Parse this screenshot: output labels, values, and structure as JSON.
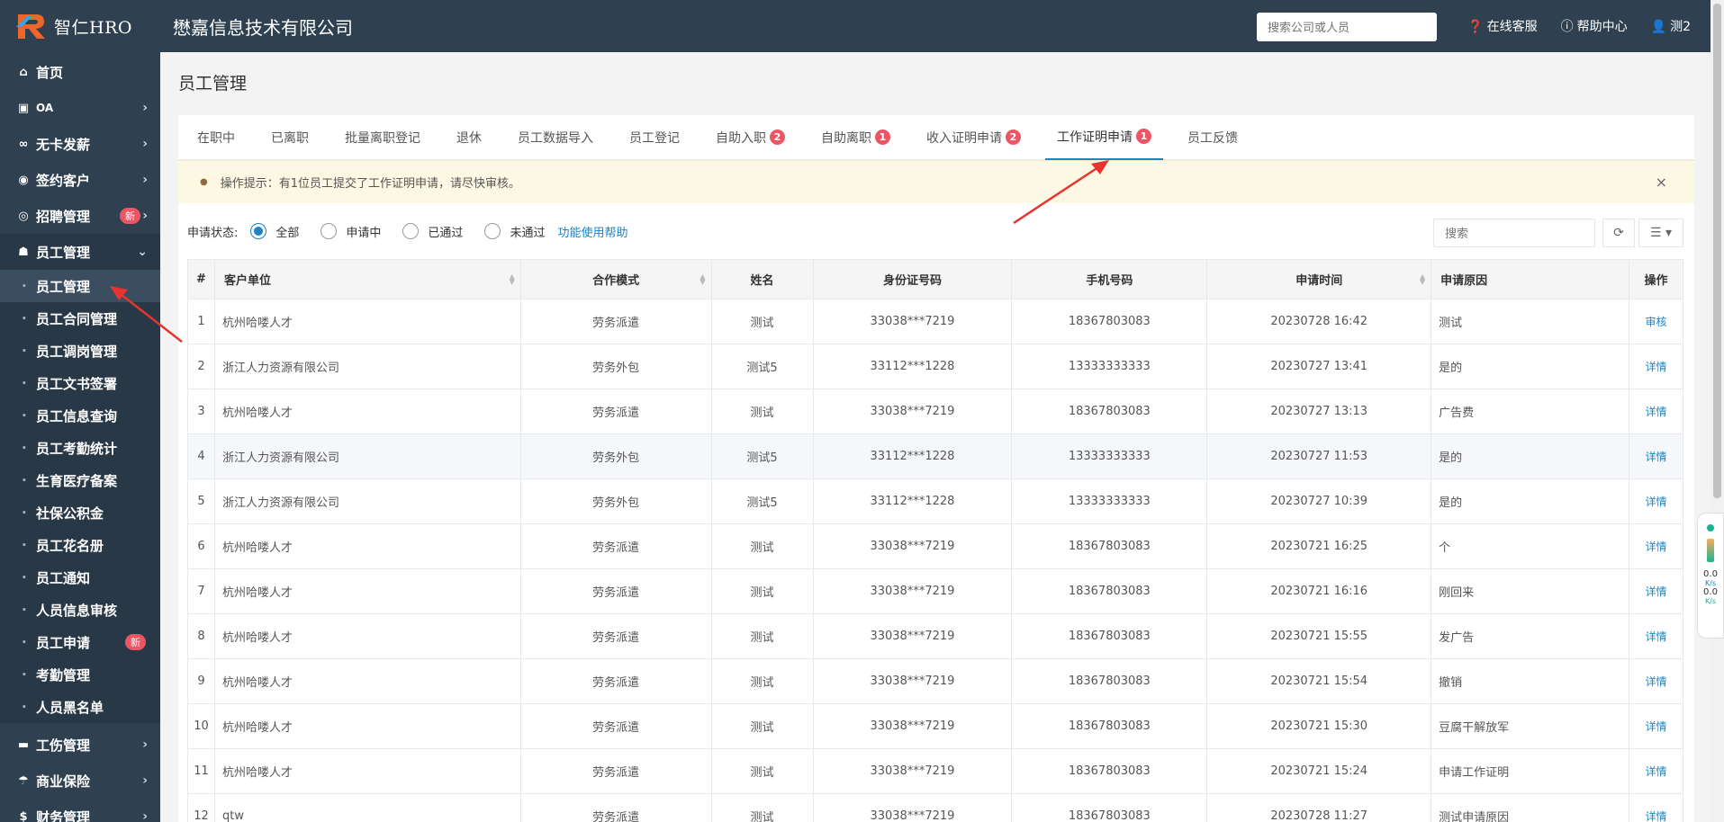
{
  "brand": {
    "name": "智仁HRO"
  },
  "sidebar": {
    "items": [
      {
        "label": "首页",
        "icon": "home-icon"
      },
      {
        "label": "OA",
        "icon": "calendar-icon"
      },
      {
        "label": "无卡发薪",
        "icon": "link-icon"
      },
      {
        "label": "签约客户",
        "icon": "user-circle-icon"
      },
      {
        "label": "招聘管理",
        "icon": "eye-icon",
        "badge": "新"
      },
      {
        "label": "员工管理",
        "icon": "users-icon"
      }
    ],
    "submenu": [
      {
        "label": "员工管理"
      },
      {
        "label": "员工合同管理"
      },
      {
        "label": "员工调岗管理"
      },
      {
        "label": "员工文书签署"
      },
      {
        "label": "员工信息查询"
      },
      {
        "label": "员工考勤统计"
      },
      {
        "label": "生育医疗备案"
      },
      {
        "label": "社保公积金"
      },
      {
        "label": "员工花名册"
      },
      {
        "label": "员工通知"
      },
      {
        "label": "人员信息审核"
      },
      {
        "label": "员工申请",
        "badge": "新"
      },
      {
        "label": "考勤管理"
      },
      {
        "label": "人员黑名单"
      }
    ],
    "bottom_items": [
      {
        "label": "工伤管理",
        "icon": "briefcase-icon"
      },
      {
        "label": "商业保险",
        "icon": "umbrella-icon"
      },
      {
        "label": "财务管理",
        "icon": "money-icon"
      }
    ]
  },
  "topbar": {
    "company": "懋嘉信息技术有限公司",
    "search_placeholder": "搜索公司或人员",
    "links": [
      "在线客服",
      "帮助中心",
      "测2"
    ]
  },
  "page": {
    "title": "员工管理"
  },
  "tabs": [
    {
      "label": "在职中"
    },
    {
      "label": "已离职"
    },
    {
      "label": "批量离职登记"
    },
    {
      "label": "退休"
    },
    {
      "label": "员工数据导入"
    },
    {
      "label": "员工登记"
    },
    {
      "label": "自助入职",
      "count": "2"
    },
    {
      "label": "自助离职",
      "count": "1"
    },
    {
      "label": "收入证明申请",
      "count": "2"
    },
    {
      "label": "工作证明申请",
      "count": "1",
      "active": true
    },
    {
      "label": "员工反馈"
    }
  ],
  "alert": {
    "text": "操作提示：有1位员工提交了工作证明申请，请尽快审核。",
    "close": "×"
  },
  "filter": {
    "label": "申请状态:",
    "options": [
      "全部",
      "申请中",
      "已通过",
      "未通过"
    ],
    "selected": "全部",
    "help": "功能使用帮助",
    "search_placeholder": "搜索"
  },
  "table": {
    "headers": [
      "#",
      "客户单位",
      "合作模式",
      "姓名",
      "身份证号码",
      "手机号码",
      "申请时间",
      "申请原因",
      "操作"
    ],
    "rows": [
      [
        "1",
        "杭州哈喽人才",
        "劳务派遣",
        "测试",
        "33038***7219",
        "18367803083",
        "20230728 16:42",
        "测试",
        "审核"
      ],
      [
        "2",
        "浙江人力资源有限公司",
        "劳务外包",
        "测试5",
        "33112***1228",
        "13333333333",
        "20230727 13:41",
        "是的",
        "详情"
      ],
      [
        "3",
        "杭州哈喽人才",
        "劳务派遣",
        "测试",
        "33038***7219",
        "18367803083",
        "20230727 13:13",
        "广告费",
        "详情"
      ],
      [
        "4",
        "浙江人力资源有限公司",
        "劳务外包",
        "测试5",
        "33112***1228",
        "13333333333",
        "20230727 11:53",
        "是的",
        "详情"
      ],
      [
        "5",
        "浙江人力资源有限公司",
        "劳务外包",
        "测试5",
        "33112***1228",
        "13333333333",
        "20230727 10:39",
        "是的",
        "详情"
      ],
      [
        "6",
        "杭州哈喽人才",
        "劳务派遣",
        "测试",
        "33038***7219",
        "18367803083",
        "20230721 16:25",
        "个",
        "详情"
      ],
      [
        "7",
        "杭州哈喽人才",
        "劳务派遣",
        "测试",
        "33038***7219",
        "18367803083",
        "20230721 16:16",
        "刚回来",
        "详情"
      ],
      [
        "8",
        "杭州哈喽人才",
        "劳务派遣",
        "测试",
        "33038***7219",
        "18367803083",
        "20230721 15:55",
        "发广告",
        "详情"
      ],
      [
        "9",
        "杭州哈喽人才",
        "劳务派遣",
        "测试",
        "33038***7219",
        "18367803083",
        "20230721 15:54",
        "撤销",
        "详情"
      ],
      [
        "10",
        "杭州哈喽人才",
        "劳务派遣",
        "测试",
        "33038***7219",
        "18367803083",
        "20230721 15:30",
        "豆腐干解放军",
        "详情"
      ],
      [
        "11",
        "杭州哈喽人才",
        "劳务派遣",
        "测试",
        "33038***7219",
        "18367803083",
        "20230721 15:24",
        "申请工作证明",
        "详情"
      ],
      [
        "12",
        "qtw",
        "劳务派遣",
        "测试",
        "33038***7219",
        "18367803083",
        "20230728 11:27",
        "测试申请原因",
        "详情"
      ]
    ]
  },
  "net_widget": {
    "up": "0.0",
    "down": "0.0",
    "unit": "K/s"
  },
  "colors": {
    "sidebar": "#2f4050",
    "accent": "#1c84c6",
    "badge": "#ed5565",
    "alert_bg": "#fcf8e3",
    "arrow": "#e8342e"
  }
}
